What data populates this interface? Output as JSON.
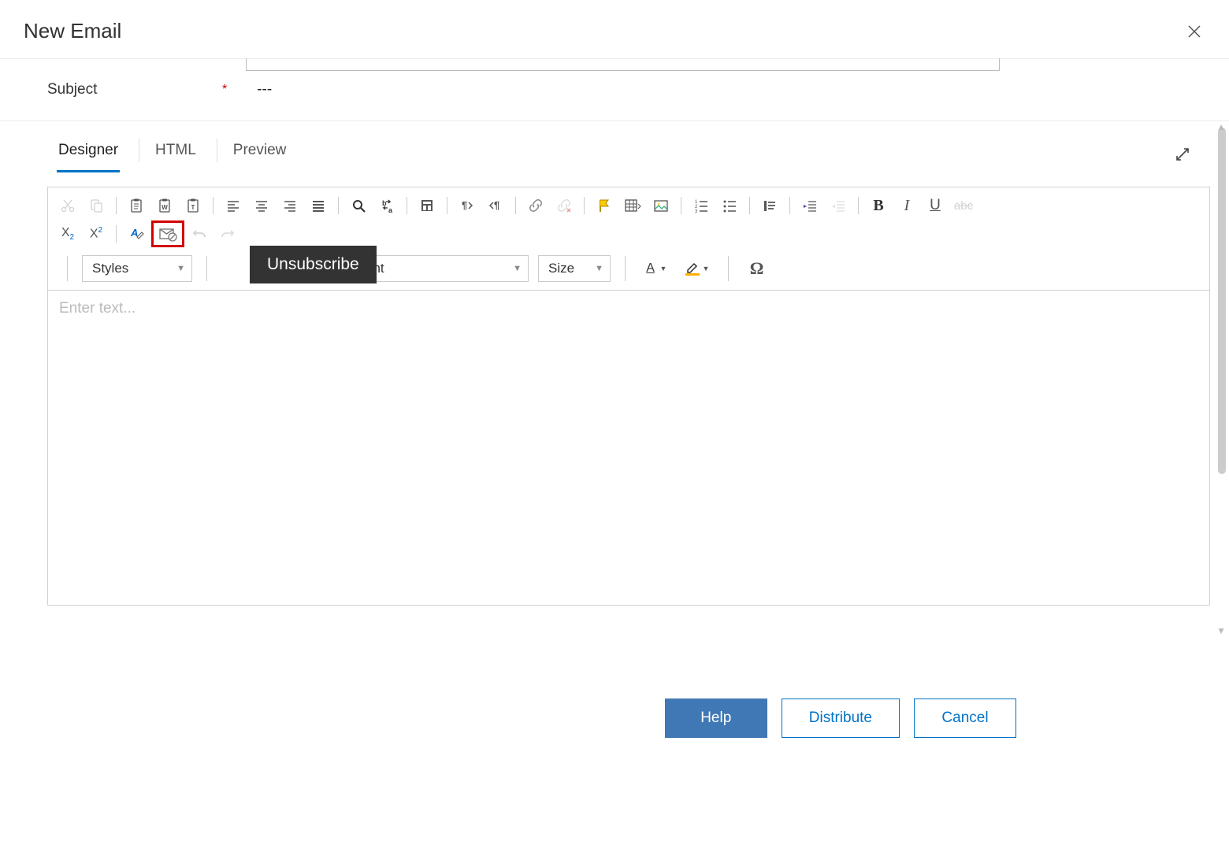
{
  "title": "New Email",
  "subject": {
    "label": "Subject",
    "required": "*",
    "value": "---"
  },
  "tabs": [
    "Designer",
    "HTML",
    "Preview"
  ],
  "active_tab": 0,
  "tooltip": "Unsubscribe",
  "selects": {
    "styles": "Styles",
    "font_partial": "ont",
    "size": "Size"
  },
  "placeholder": "Enter text...",
  "buttons": {
    "help": "Help",
    "distribute": "Distribute",
    "cancel": "Cancel"
  },
  "colors": {
    "text_color": "#c00000",
    "highlight_color": "#ffb000"
  }
}
